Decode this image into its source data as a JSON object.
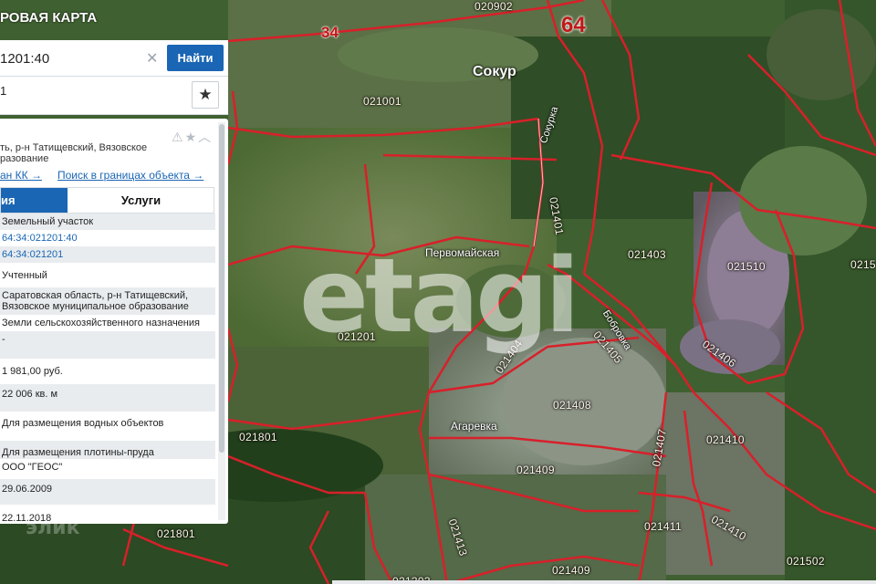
{
  "colors": {
    "boundary": "#d8202a",
    "accent": "#1a66b4",
    "region_label": "#c01818"
  },
  "topbar": {
    "title": "РОВАЯ КАРТА"
  },
  "search": {
    "value": "1201:40",
    "find_label": "Найти"
  },
  "result": {
    "count": "1",
    "favorite_icon": "star-icon"
  },
  "panel": {
    "tool_icons": [
      "warning-icon",
      "star-icon",
      "chevron-up-icon"
    ],
    "address": "ть, р-н Татищевский, Вязовское\nразование",
    "link_plan": "ан КК →",
    "link_search": "Поиск в границах объекта →",
    "tabs": {
      "info": "ия",
      "services": "Услуги"
    },
    "rows": [
      "Земельный участок",
      "64:34:021201:40",
      "64:34:021201",
      "Учтенный",
      "Саратовская область, р-н Татищевский, Вязовское муниципальное образование",
      "Земли сельскохозяйственного назначения",
      "-",
      "1 981,00 руб.",
      "",
      "22 006 кв. м",
      "",
      "Для размещения водных объектов",
      "",
      "Для размещения плотины-пруда",
      "ООО \"ГЕОС\"",
      "",
      "29.06.2009",
      "",
      "22.11.2018"
    ]
  },
  "map": {
    "region_big": "64",
    "region_small": "34",
    "places": {
      "sokur": "Сокур",
      "pervomayskaya": "Первомайская",
      "agarevka": "Агаревка"
    },
    "water_labels": [
      "Сокурка",
      "Бобровка"
    ],
    "parcels": [
      "020902",
      "021001",
      "021401",
      "021403",
      "021510",
      "0215",
      "021201",
      "021404",
      "021405",
      "021406",
      "021408",
      "021407",
      "021410",
      "021801",
      "021409",
      "021411",
      "021410",
      "021801",
      "021413",
      "021409",
      "021502",
      "021303"
    ],
    "watermark": "etagi",
    "faint_logo": "элик"
  }
}
